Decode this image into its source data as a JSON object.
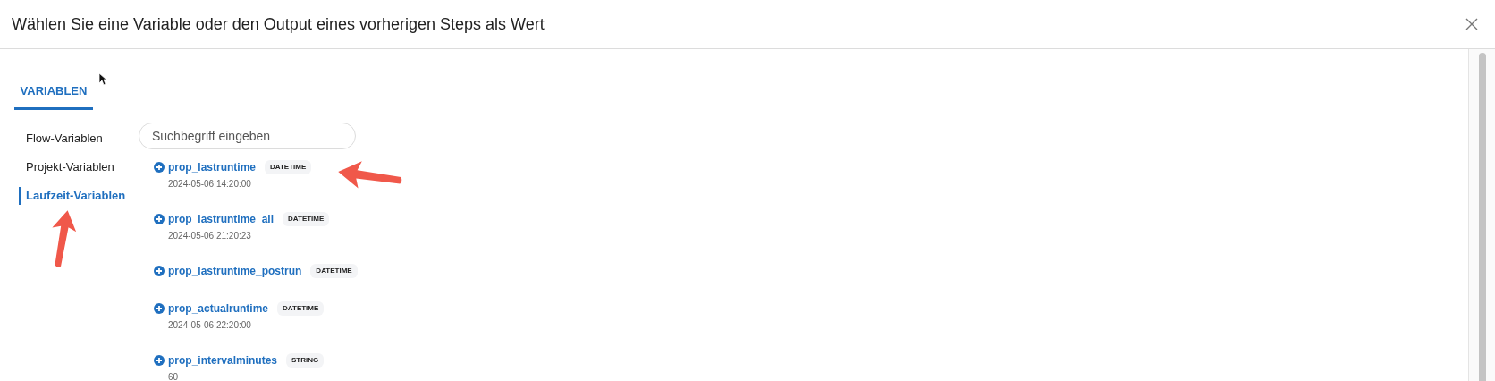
{
  "dialog": {
    "title": "Wählen Sie eine Variable oder den Output eines vorherigen Steps als Wert"
  },
  "tabs": [
    {
      "label": "VARIABLEN",
      "selected": true
    }
  ],
  "sidebar": {
    "items": [
      {
        "label": "Flow-Variablen",
        "selected": false
      },
      {
        "label": "Projekt-Variablen",
        "selected": false
      },
      {
        "label": "Laufzeit-Variablen",
        "selected": true
      }
    ]
  },
  "search": {
    "placeholder": "Suchbegriff eingeben"
  },
  "variables": [
    {
      "name": "prop_lastruntime",
      "type": "DATETIME",
      "value": "2024-05-06 14:20:00"
    },
    {
      "name": "prop_lastruntime_all",
      "type": "DATETIME",
      "value": "2024-05-06 21:20:23"
    },
    {
      "name": "prop_lastruntime_postrun",
      "type": "DATETIME"
    },
    {
      "name": "prop_actualruntime",
      "type": "DATETIME",
      "value": "2024-05-06 22:20:00"
    },
    {
      "name": "prop_intervalminutes",
      "type": "STRING",
      "value": "60"
    }
  ]
}
